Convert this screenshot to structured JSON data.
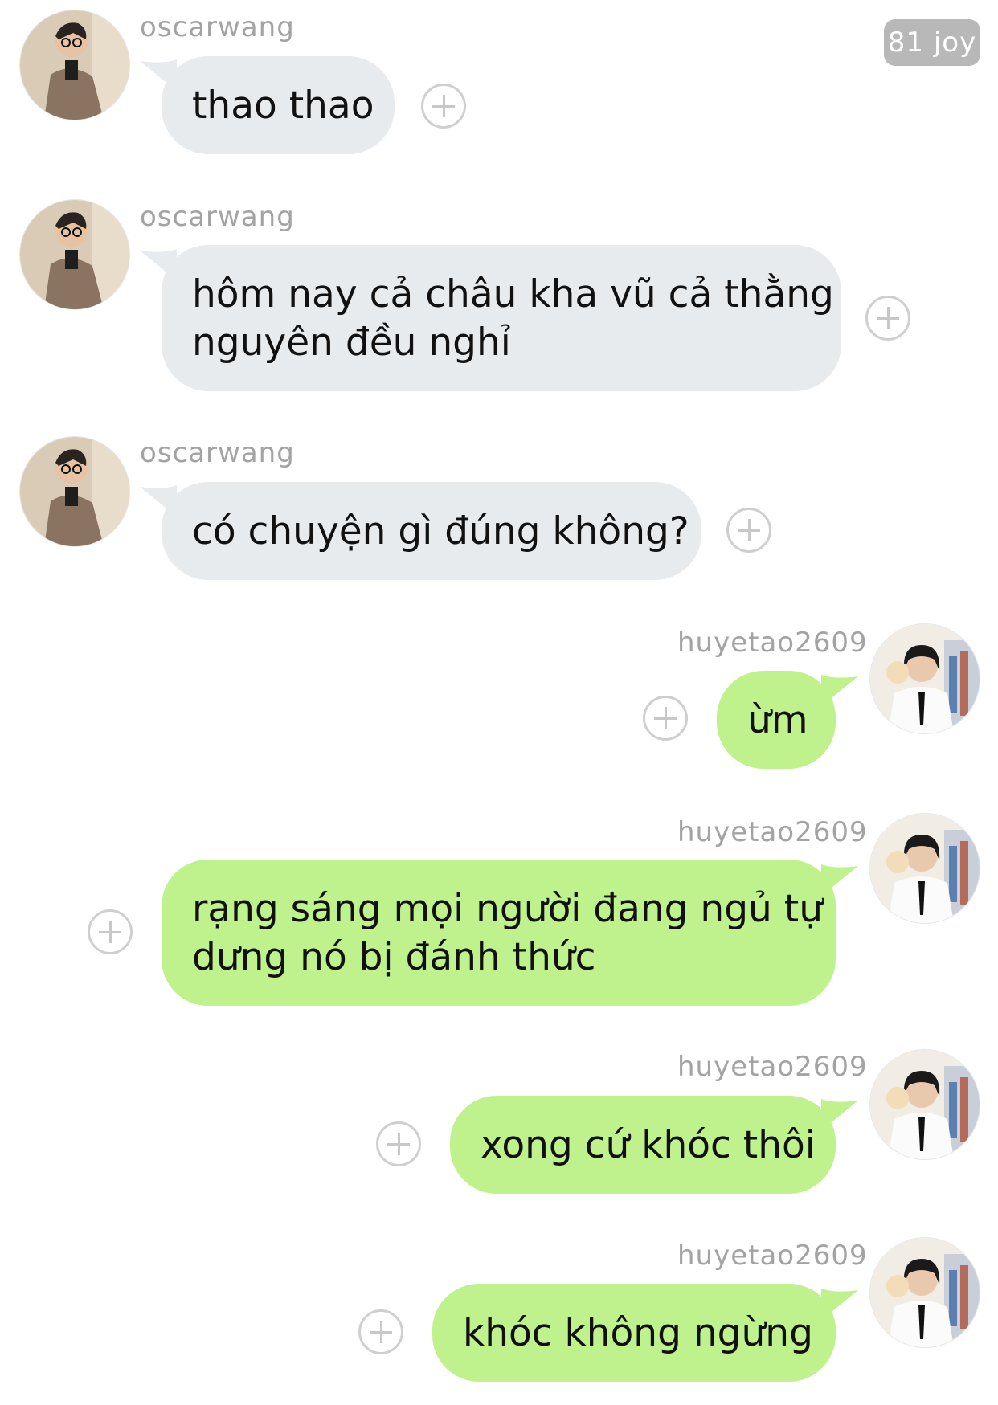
{
  "badge": {
    "text": "81 joy"
  },
  "messages": [
    {
      "user": "oscarwang",
      "side": "in",
      "lines": [
        "thao thao"
      ]
    },
    {
      "user": "oscarwang",
      "side": "in",
      "lines": [
        "hôm nay cả châu kha vũ cả thằng",
        "nguyên đều nghỉ"
      ]
    },
    {
      "user": "oscarwang",
      "side": "in",
      "lines": [
        "có chuyện gì đúng không?"
      ]
    },
    {
      "user": "huyetao2609",
      "side": "out",
      "lines": [
        "ừm"
      ]
    },
    {
      "user": "huyetao2609",
      "side": "out",
      "lines": [
        "rạng sáng mọi người đang ngủ tự",
        "dưng nó bị đánh thức"
      ]
    },
    {
      "user": "huyetao2609",
      "side": "out",
      "lines": [
        "xong cứ khóc thôi"
      ]
    },
    {
      "user": "huyetao2609",
      "side": "out",
      "lines": [
        "khóc không ngừng"
      ]
    }
  ],
  "colors": {
    "incoming_bubble": "#e8ebee",
    "outgoing_bubble": "#bff18d",
    "username": "#a3a3a3"
  },
  "icons": {
    "add_reaction": "plus-circle-icon"
  }
}
